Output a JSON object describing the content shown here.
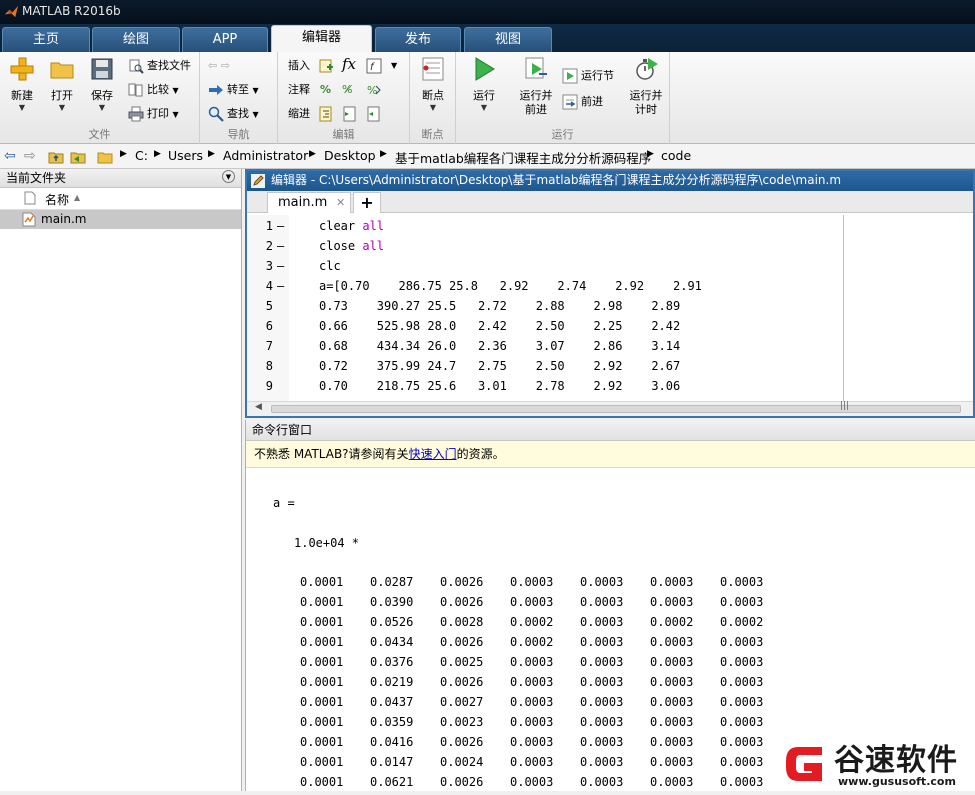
{
  "app": {
    "title": "MATLAB R2016b"
  },
  "ribbon_tabs": [
    {
      "label": "主页",
      "active": false
    },
    {
      "label": "绘图",
      "active": false
    },
    {
      "label": "APP",
      "active": false
    },
    {
      "label": "编辑器",
      "active": true
    },
    {
      "label": "发布",
      "active": false
    },
    {
      "label": "视图",
      "active": false
    }
  ],
  "ribbon": {
    "file": {
      "group": "文件",
      "new": "新建",
      "open": "打开",
      "save": "保存",
      "find_files": "查找文件",
      "compare": "比较",
      "print": "打印"
    },
    "nav": {
      "group": "导航",
      "goto": "转至",
      "find": "查找"
    },
    "edit": {
      "group": "编辑",
      "insert": "插入",
      "comment": "注释",
      "indent": "缩进",
      "fx": "fx"
    },
    "breakpoints": {
      "group": "断点",
      "label": "断点"
    },
    "run": {
      "group": "运行",
      "run": "运行",
      "run_advance": [
        "运行并",
        "前进"
      ],
      "run_section": "运行节",
      "advance": "前进",
      "run_time": [
        "运行并",
        "计时"
      ]
    }
  },
  "address": {
    "parts": [
      "C:",
      "Users",
      "Administrator",
      "Desktop",
      "基于matlab编程各门课程主成分分析源码程序",
      "code"
    ]
  },
  "current_folder": {
    "title": "当前文件夹",
    "column": "名称",
    "files": [
      "main.m"
    ]
  },
  "editor": {
    "title": "编辑器 - C:\\Users\\Administrator\\Desktop\\基于matlab编程各门课程主成分分析源码程序\\code\\main.m",
    "tab": "main.m",
    "add": "+",
    "lines": [
      {
        "n": "1",
        "dash": "—",
        "code": "clear ",
        "kw": "all"
      },
      {
        "n": "2",
        "dash": "—",
        "code": "close ",
        "kw": "all"
      },
      {
        "n": "3",
        "dash": "—",
        "code": "clc",
        "kw": ""
      },
      {
        "n": "4",
        "dash": "—",
        "code": "a=[0.70    286.75 25.8   2.92    2.74    2.92    2.91",
        "kw": ""
      },
      {
        "n": "5",
        "dash": "",
        "code": "0.73    390.27 25.5   2.72    2.88    2.98    2.89",
        "kw": ""
      },
      {
        "n": "6",
        "dash": "",
        "code": "0.66    525.98 28.0   2.42    2.50    2.25    2.42",
        "kw": ""
      },
      {
        "n": "7",
        "dash": "",
        "code": "0.68    434.34 26.0   2.36    3.07    2.86    3.14",
        "kw": ""
      },
      {
        "n": "8",
        "dash": "",
        "code": "0.72    375.99 24.7   2.75    2.50    2.92    2.67",
        "kw": ""
      },
      {
        "n": "9",
        "dash": "",
        "code": "0.70    218.75 25.6   3.01    2.78    2.92    3.06",
        "kw": ""
      }
    ]
  },
  "command_window": {
    "title": "命令行窗口",
    "notice_pre": "不熟悉 MATLAB?请参阅有关",
    "notice_link": "快速入门",
    "notice_post": "的资源。",
    "var": "a =",
    "scale": "1.0e+04 *",
    "matrix": [
      [
        "0.0001",
        "0.0287",
        "0.0026",
        "0.0003",
        "0.0003",
        "0.0003",
        "0.0003"
      ],
      [
        "0.0001",
        "0.0390",
        "0.0026",
        "0.0003",
        "0.0003",
        "0.0003",
        "0.0003"
      ],
      [
        "0.0001",
        "0.0526",
        "0.0028",
        "0.0002",
        "0.0003",
        "0.0002",
        "0.0002"
      ],
      [
        "0.0001",
        "0.0434",
        "0.0026",
        "0.0002",
        "0.0003",
        "0.0003",
        "0.0003"
      ],
      [
        "0.0001",
        "0.0376",
        "0.0025",
        "0.0003",
        "0.0003",
        "0.0003",
        "0.0003"
      ],
      [
        "0.0001",
        "0.0219",
        "0.0026",
        "0.0003",
        "0.0003",
        "0.0003",
        "0.0003"
      ],
      [
        "0.0001",
        "0.0437",
        "0.0027",
        "0.0003",
        "0.0003",
        "0.0003",
        "0.0003"
      ],
      [
        "0.0001",
        "0.0359",
        "0.0023",
        "0.0003",
        "0.0003",
        "0.0003",
        "0.0003"
      ],
      [
        "0.0001",
        "0.0416",
        "0.0026",
        "0.0003",
        "0.0003",
        "0.0003",
        "0.0003"
      ],
      [
        "0.0001",
        "0.0147",
        "0.0024",
        "0.0003",
        "0.0003",
        "0.0003",
        "0.0003"
      ],
      [
        "0.0001",
        "0.0621",
        "0.0026",
        "0.0003",
        "0.0003",
        "0.0003",
        "0.0003"
      ]
    ]
  },
  "watermark": {
    "brand": "谷速软件",
    "url": "www.gususoft.com",
    "color": "#e31c23"
  },
  "colors": {
    "title_bar": "#0b1a2a",
    "tab_blue": "#3e6e9e",
    "editor_border": "#3a75b0",
    "keyword": "#b200b2",
    "notice_bg": "#fffbdc"
  }
}
